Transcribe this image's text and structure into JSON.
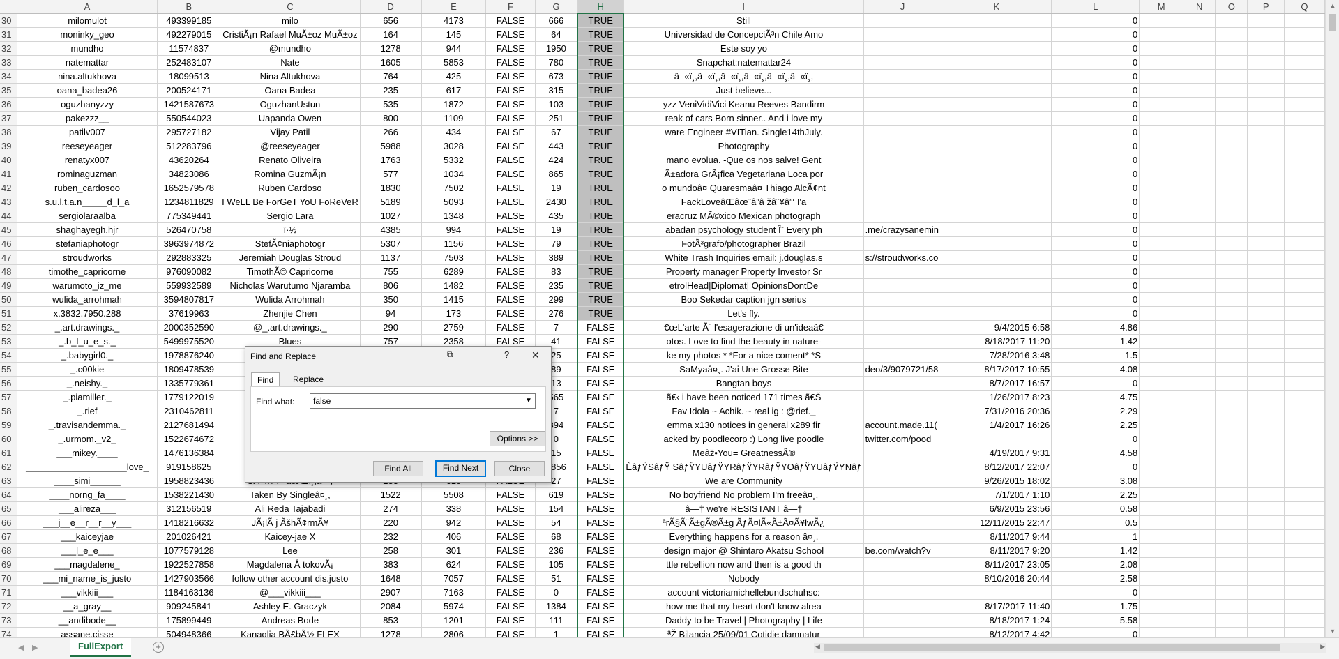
{
  "columns": [
    "A",
    "B",
    "C",
    "D",
    "E",
    "F",
    "G",
    "H",
    "I",
    "J",
    "K",
    "L",
    "M",
    "N",
    "O",
    "P",
    "Q"
  ],
  "selected_column": "H",
  "rows": [
    {
      "n": "30",
      "a": "milomulot",
      "b": "493399185",
      "c": "milo",
      "d": "656",
      "e": "4173",
      "f": "FALSE",
      "g": "666",
      "h": "TRUE",
      "i": "Still",
      "j": "",
      "k": "",
      "l": "0"
    },
    {
      "n": "31",
      "a": "moninky_geo",
      "b": "492279015",
      "c": "CristiÃ¡n Rafael MuÃ±oz MuÃ±oz",
      "d": "164",
      "e": "145",
      "f": "FALSE",
      "g": "64",
      "h": "TRUE",
      "i": "Universidad de ConcepciÃ³n  Chile Amo",
      "j": "",
      "k": "",
      "l": "0"
    },
    {
      "n": "32",
      "a": "mundho",
      "b": "11574837",
      "c": "@mundho",
      "d": "1278",
      "e": "944",
      "f": "FALSE",
      "g": "1950",
      "h": "TRUE",
      "i": "Este soy yo",
      "j": "",
      "k": "",
      "l": "0"
    },
    {
      "n": "33",
      "a": "natemattar",
      "b": "252483107",
      "c": "Nate",
      "d": "1605",
      "e": "5853",
      "f": "FALSE",
      "g": "780",
      "h": "TRUE",
      "i": "Snapchat:natemattar24",
      "j": "",
      "k": "",
      "l": "0"
    },
    {
      "n": "34",
      "a": "nina.altukhova",
      "b": "18099513",
      "c": "Nina Altukhova",
      "d": "764",
      "e": "425",
      "f": "FALSE",
      "g": "673",
      "h": "TRUE",
      "i": "â–«ï¸,â–«ï¸,â–«ï¸,â–«ï¸,â–«ï¸,â–«ï¸,",
      "j": "",
      "k": "",
      "l": "0"
    },
    {
      "n": "35",
      "a": "oana_badea26",
      "b": "200524171",
      "c": "Oana Badea",
      "d": "235",
      "e": "617",
      "f": "FALSE",
      "g": "315",
      "h": "TRUE",
      "i": "Just believe...",
      "j": "",
      "k": "",
      "l": "0"
    },
    {
      "n": "36",
      "a": "oguzhanyzzy",
      "b": "1421587673",
      "c": "OguzhanUstun",
      "d": "535",
      "e": "1872",
      "f": "FALSE",
      "g": "103",
      "h": "TRUE",
      "i": "yzz VeniVidiVici Keanu Reeves Bandirm",
      "j": "",
      "k": "",
      "l": "0"
    },
    {
      "n": "37",
      "a": "pakezzz__",
      "b": "550544023",
      "c": "Uapanda Owen",
      "d": "800",
      "e": "1109",
      "f": "FALSE",
      "g": "251",
      "h": "TRUE",
      "i": "reak of cars Born sinner.. And i love my",
      "j": "",
      "k": "",
      "l": "0"
    },
    {
      "n": "38",
      "a": "patilv007",
      "b": "295727182",
      "c": "Vijay Patil",
      "d": "266",
      "e": "434",
      "f": "FALSE",
      "g": "67",
      "h": "TRUE",
      "i": "ware Engineer  #VITian. Single14thJuly.",
      "j": "",
      "k": "",
      "l": "0"
    },
    {
      "n": "39",
      "a": "reeseyeager",
      "b": "512283796",
      "c": "@reeseyeager",
      "d": "5988",
      "e": "3028",
      "f": "FALSE",
      "g": "443",
      "h": "TRUE",
      "i": "Photography",
      "j": "",
      "k": "",
      "l": "0"
    },
    {
      "n": "40",
      "a": "renatyx007",
      "b": "43620264",
      "c": "Renato Oliveira",
      "d": "1763",
      "e": "5332",
      "f": "FALSE",
      "g": "424",
      "h": "TRUE",
      "i": "mano evolua. -Que os  nos salve!   Gent",
      "j": "",
      "k": "",
      "l": "0"
    },
    {
      "n": "41",
      "a": "rominaguzman",
      "b": "34823086",
      "c": "Romina GuzmÃ¡n",
      "d": "577",
      "e": "1034",
      "f": "FALSE",
      "g": "865",
      "h": "TRUE",
      "i": "Ã±adora GrÃ¡fica Vegetariana Loca por",
      "j": "",
      "k": "",
      "l": "0"
    },
    {
      "n": "42",
      "a": "ruben_cardosoo",
      "b": "1652579578",
      "c": "Ruben Cardoso",
      "d": "1830",
      "e": "7502",
      "f": "FALSE",
      "g": "19",
      "h": "TRUE",
      "i": "o mundoâ¤ Quaresmaâ¤ Thiago AlcÃ¢nt",
      "j": "",
      "k": "",
      "l": "0"
    },
    {
      "n": "43",
      "a": "s.u.l.t.a.n_____d_l_a",
      "b": "1234811829",
      "c": "I WeLL Be ForGeT YoU FoReVeR",
      "d": "5189",
      "e": "5093",
      "f": "FALSE",
      "g": "2430",
      "h": "TRUE",
      "i": "FackLoveâŒâœ˜â”â žâ˜¥â”‘   I'a",
      "j": "",
      "k": "",
      "l": "0"
    },
    {
      "n": "44",
      "a": "sergiolaraalba",
      "b": "775349441",
      "c": "Sergio Lara",
      "d": "1027",
      "e": "1348",
      "f": "FALSE",
      "g": "435",
      "h": "TRUE",
      "i": "eracruz  MÃ©xico  Mexican photograph",
      "j": "",
      "k": "",
      "l": "0"
    },
    {
      "n": "45",
      "a": "shaghayegh.hjr",
      "b": "526470758",
      "c": "ï·½",
      "d": "4385",
      "e": "994",
      "f": "FALSE",
      "g": "19",
      "h": "TRUE",
      "i": "abadan psychology student Î˜ Every ph",
      "j": ".me/crazysanemin",
      "k": "",
      "l": "0"
    },
    {
      "n": "46",
      "a": "stefaniaphotogr",
      "b": "3963974872",
      "c": "StefÃ¢niaphotogr",
      "d": "5307",
      "e": "1156",
      "f": "FALSE",
      "g": "79",
      "h": "TRUE",
      "i": "FotÃ³grafo/photographer Brazil",
      "j": "",
      "k": "",
      "l": "0"
    },
    {
      "n": "47",
      "a": "stroudworks",
      "b": "292883325",
      "c": "Jeremiah Douglas Stroud",
      "d": "1137",
      "e": "7503",
      "f": "FALSE",
      "g": "389",
      "h": "TRUE",
      "i": "White Trash Inquiries email: j.douglas.s",
      "j": "s://stroudworks.co",
      "k": "",
      "l": "0"
    },
    {
      "n": "48",
      "a": "timothe_capricorne",
      "b": "976090082",
      "c": "TimothÃ© Capricorne",
      "d": "755",
      "e": "6289",
      "f": "FALSE",
      "g": "83",
      "h": "TRUE",
      "i": "Property manager Property Investor  Sr",
      "j": "",
      "k": "",
      "l": "0"
    },
    {
      "n": "49",
      "a": "warumoto_iz_me",
      "b": "559932589",
      "c": "Nicholas Warutumo Njaramba",
      "d": "806",
      "e": "1482",
      "f": "FALSE",
      "g": "235",
      "h": "TRUE",
      "i": "etrolHead|Diplomat| OpinionsDontDe",
      "j": "",
      "k": "",
      "l": "0"
    },
    {
      "n": "50",
      "a": "wulida_arrohmah",
      "b": "3594807817",
      "c": "Wulida Arrohmah",
      "d": "350",
      "e": "1415",
      "f": "FALSE",
      "g": "299",
      "h": "TRUE",
      "i": "Boo Sekedar caption jgn serius",
      "j": "",
      "k": "",
      "l": "0"
    },
    {
      "n": "51",
      "a": "x.3832.7950.288",
      "b": "37619963",
      "c": "Zhenjie Chen",
      "d": "94",
      "e": "173",
      "f": "FALSE",
      "g": "276",
      "h": "TRUE",
      "i": "Let's fly.",
      "j": "",
      "k": "",
      "l": "0"
    },
    {
      "n": "52",
      "a": "_.art.drawings._",
      "b": "2000352590",
      "c": "@_.art.drawings._",
      "d": "290",
      "e": "2759",
      "f": "FALSE",
      "g": "7",
      "h": "FALSE",
      "i": "€œL'arte Ã¨ l'esagerazione di un'ideaâ€",
      "j": "",
      "k": "9/4/2015 6:58",
      "l": "4.86"
    },
    {
      "n": "53",
      "a": "_.b_l_u_e_s._",
      "b": "5499975520",
      "c": "Blues",
      "d": "757",
      "e": "2358",
      "f": "FALSE",
      "g": "41",
      "h": "FALSE",
      "i": "otos. Love to find the beauty in nature-",
      "j": "",
      "k": "8/18/2017 11:20",
      "l": "1.42"
    },
    {
      "n": "54",
      "a": "_.babygirl0._",
      "b": "1978876240",
      "c": "",
      "d": "",
      "e": "",
      "f": "",
      "g": "25",
      "h": "FALSE",
      "i": "ke my photos  *  *For a nice coment*  *S",
      "j": "",
      "k": "7/28/2016 3:48",
      "l": "1.5"
    },
    {
      "n": "55",
      "a": "_.c00kie",
      "b": "1809478539",
      "c": "",
      "d": "",
      "e": "",
      "f": "",
      "g": "89",
      "h": "FALSE",
      "i": "SaMyaâ¤¸. J'ai Une Grosse Bite",
      "j": "deo/3/9079721/58",
      "k": "8/17/2017 10:55",
      "l": "4.08"
    },
    {
      "n": "56",
      "a": "_.neishy._",
      "b": "1335779361",
      "c": "",
      "d": "",
      "e": "",
      "f": "",
      "g": "13",
      "h": "FALSE",
      "i": "Bangtan boys",
      "j": "",
      "k": "8/7/2017 16:57",
      "l": "0"
    },
    {
      "n": "57",
      "a": "_.piamiller._",
      "b": "1779122019",
      "c": "",
      "d": "",
      "e": "",
      "f": "",
      "g": "565",
      "h": "FALSE",
      "i": "ã€‹ i have been noticed 171 times  ã€Š",
      "j": "",
      "k": "1/26/2017 8:23",
      "l": "4.75"
    },
    {
      "n": "58",
      "a": "_.rief",
      "b": "2310462811",
      "c": "",
      "d": "",
      "e": "",
      "f": "",
      "g": "7",
      "h": "FALSE",
      "i": "Fav Idola  ~ Achik. ~ real ig : @rief._",
      "j": "",
      "k": "7/31/2016 20:36",
      "l": "2.29"
    },
    {
      "n": "59",
      "a": "_.travisandemma._",
      "b": "2127681494",
      "c": "",
      "d": "",
      "e": "",
      "f": "",
      "g": "394",
      "h": "FALSE",
      "i": "emma x130  notices in general x289  fir",
      "j": "account.made.11(",
      "k": "1/4/2017 16:26",
      "l": "2.25"
    },
    {
      "n": "60",
      "a": "_.urmom._v2_",
      "b": "1522674672",
      "c": "",
      "d": "",
      "e": "",
      "f": "",
      "g": "0",
      "h": "FALSE",
      "i": "acked by poodlecorp :) Long live poodle",
      "j": "twitter.com/pood",
      "k": "",
      "l": "0"
    },
    {
      "n": "61",
      "a": "___mikey.____",
      "b": "1476136384",
      "c": "",
      "d": "",
      "e": "",
      "f": "",
      "g": "15",
      "h": "FALSE",
      "i": "Meâž•You= GreatnessÂ®",
      "j": "",
      "k": "4/19/2017 9:31",
      "l": "4.58"
    },
    {
      "n": "62",
      "a": "____________________love_",
      "b": "919158625",
      "c": "",
      "d": "",
      "e": "",
      "f": "",
      "g": "1856",
      "h": "FALSE",
      "i": "ÈâƒŸSâƒŸ SâƒŸYUâƒŸYRâƒŸYRâƒŸYOâƒŸYUâƒŸYNâƒ",
      "j": "",
      "k": "8/12/2017 22:07",
      "l": "0"
    },
    {
      "n": "63",
      "a": "____simi______",
      "b": "1958823436",
      "c": "SA~mA« âœŒï¸,â~º,",
      "d": "233",
      "e": "610",
      "f": "FALSE",
      "g": "27",
      "h": "FALSE",
      "i": "We are Community",
      "j": "",
      "k": "9/26/2015 18:02",
      "l": "3.08"
    },
    {
      "n": "64",
      "a": "____norng_fa____",
      "b": "1538221430",
      "c": "Taken By Singleâ¤¸,",
      "d": "1522",
      "e": "5508",
      "f": "FALSE",
      "g": "619",
      "h": "FALSE",
      "i": "No boyfriend No problem I'm freeâ¤¸,",
      "j": "",
      "k": "7/1/2017 1:10",
      "l": "2.25"
    },
    {
      "n": "65",
      "a": "___alireza___",
      "b": "312156519",
      "c": "Ali Reda Tajabadi",
      "d": "274",
      "e": "338",
      "f": "FALSE",
      "g": "154",
      "h": "FALSE",
      "i": "â—† we're RESISTANT â—†",
      "j": "",
      "k": "6/9/2015 23:56",
      "l": "0.58"
    },
    {
      "n": "66",
      "a": "___j__e__r__r__y___",
      "b": "1418216632",
      "c": "JÃ¡lÃ j ÃšhÃ¢rmÃ¥",
      "d": "220",
      "e": "942",
      "f": "FALSE",
      "g": "54",
      "h": "FALSE",
      "i": "ªrÃ§Ã¨Ã±gÃ®Ã±g ÃƒÃ¤lÃ«Ã±Ã¤Ã¥lwÃ¿",
      "j": "",
      "k": "12/11/2015 22:47",
      "l": "0.5"
    },
    {
      "n": "67",
      "a": "___kaiceyjae",
      "b": "201026421",
      "c": "Kaicey-jae X",
      "d": "232",
      "e": "406",
      "f": "FALSE",
      "g": "68",
      "h": "FALSE",
      "i": "Everything happens for a reason â¤¸,",
      "j": "",
      "k": "8/11/2017 9:44",
      "l": "1"
    },
    {
      "n": "68",
      "a": "___l_e_e___",
      "b": "1077579128",
      "c": "Lee",
      "d": "258",
      "e": "301",
      "f": "FALSE",
      "g": "236",
      "h": "FALSE",
      "i": "design major @ Shintaro Akatsu School",
      "j": "be.com/watch?v=",
      "k": "8/11/2017 9:20",
      "l": "1.42"
    },
    {
      "n": "69",
      "a": "___magdalene_",
      "b": "1922527858",
      "c": "Magdalena Å tokovÃ¡",
      "d": "383",
      "e": "624",
      "f": "FALSE",
      "g": "105",
      "h": "FALSE",
      "i": "ttle rebellion now and then is a good th",
      "j": "",
      "k": "8/11/2017 23:05",
      "l": "2.08"
    },
    {
      "n": "70",
      "a": "___mi_name_is_justo",
      "b": "1427903566",
      "c": "follow other account dis.justo",
      "d": "1648",
      "e": "7057",
      "f": "FALSE",
      "g": "51",
      "h": "FALSE",
      "i": "Nobody",
      "j": "",
      "k": "8/10/2016 20:44",
      "l": "2.58"
    },
    {
      "n": "71",
      "a": "___vikkiii___",
      "b": "1184163136",
      "c": "@___vikkiii___",
      "d": "2907",
      "e": "7163",
      "f": "FALSE",
      "g": "0",
      "h": "FALSE",
      "i": "account victoriamichellebundschuhsc:",
      "j": "",
      "k": "",
      "l": "0"
    },
    {
      "n": "72",
      "a": "__a_gray__",
      "b": "909245841",
      "c": "Ashley E. Graczyk",
      "d": "2084",
      "e": "5974",
      "f": "FALSE",
      "g": "1384",
      "h": "FALSE",
      "i": "how me that my heart don't know alrea",
      "j": "",
      "k": "8/17/2017 11:40",
      "l": "1.75"
    },
    {
      "n": "73",
      "a": "__andibode__",
      "b": "175899449",
      "c": "Andreas Bode",
      "d": "853",
      "e": "1201",
      "f": "FALSE",
      "g": "111",
      "h": "FALSE",
      "i": "Daddy to be Travel  | Photography  | Life",
      "j": "",
      "k": "8/18/2017 1:24",
      "l": "5.58"
    },
    {
      "n": "74",
      "a": "assane.cisse",
      "b": "504948366",
      "c": "Kanaglia BÃ£bÃ½ FLEX",
      "d": "1278",
      "e": "2806",
      "f": "FALSE",
      "g": "1",
      "h": "FALSE",
      "i": "ªŽ Bilancia  25/09/01 Cotidie damnatur",
      "j": "",
      "k": "8/12/2017 4:42",
      "l": "0"
    }
  ],
  "sheet_tab": "FullExport",
  "dialog": {
    "title": "Find and Replace",
    "help": "?",
    "close_x": "✕",
    "tab_find": "Find",
    "tab_replace": "Replace",
    "find_what_label": "Find what:",
    "find_what_value": "false",
    "options_button": "Options >>",
    "find_all_button": "Find All",
    "find_next_button": "Find Next",
    "close_button": "Close"
  },
  "icons": {
    "add_sheet": "plus-circle-icon",
    "restore": "restore-window-icon",
    "nav_prev": "triangle-left-icon",
    "nav_next": "triangle-right-icon"
  }
}
